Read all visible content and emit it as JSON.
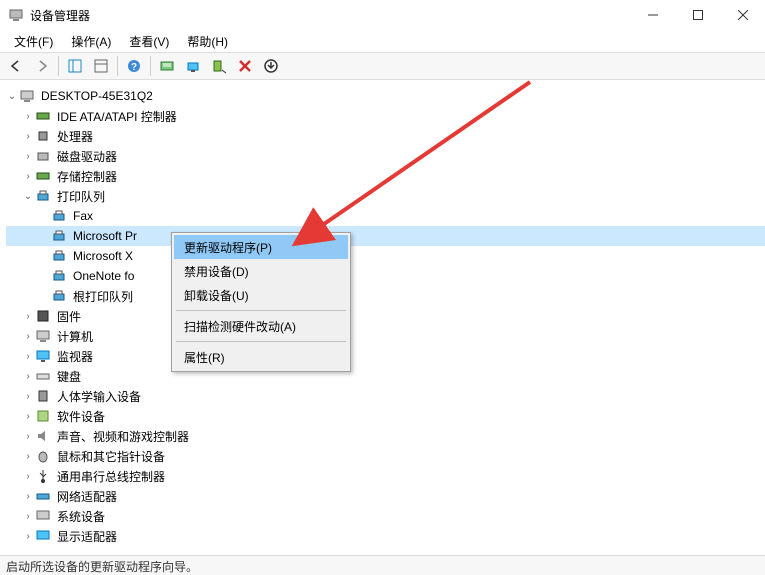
{
  "window": {
    "title": "设备管理器"
  },
  "menus": {
    "file": "文件(F)",
    "action": "操作(A)",
    "view": "查看(V)",
    "help": "帮助(H)"
  },
  "tree": {
    "root": "DESKTOP-45E31Q2",
    "ide": "IDE ATA/ATAPI 控制器",
    "cpu": "处理器",
    "disk": "磁盘驱动器",
    "storage": "存储控制器",
    "printq": "打印队列",
    "fax": "Fax",
    "msprint": "Microsoft Pr",
    "msxps": "Microsoft X",
    "onenote": "OneNote fo",
    "rootprint": "根打印队列",
    "firmware": "固件",
    "computer": "计算机",
    "monitor": "监视器",
    "keyboard": "键盘",
    "hid": "人体学输入设备",
    "software": "软件设备",
    "audio": "声音、视频和游戏控制器",
    "mouse": "鼠标和其它指针设备",
    "usb": "通用串行总线控制器",
    "network": "网络适配器",
    "system": "系统设备",
    "display": "显示适配器"
  },
  "context": {
    "update": "更新驱动程序(P)",
    "disable": "禁用设备(D)",
    "uninstall": "卸载设备(U)",
    "scan": "扫描检测硬件改动(A)",
    "properties": "属性(R)"
  },
  "status": "启动所选设备的更新驱动程序向导。"
}
